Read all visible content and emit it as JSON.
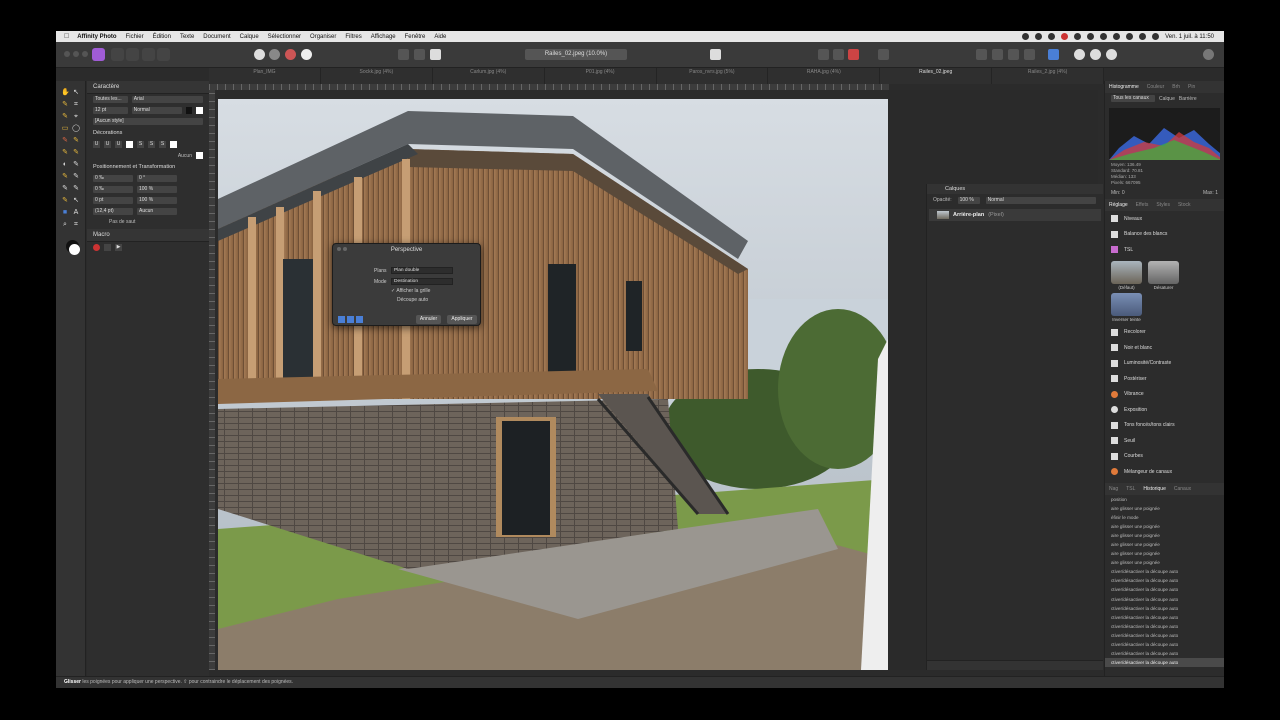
{
  "menubar": {
    "app_name": "Affinity Photo",
    "items": [
      "Fichier",
      "Édition",
      "Texte",
      "Document",
      "Calque",
      "Sélectionner",
      "Organiser",
      "Filtres",
      "Affichage",
      "Fenêtre",
      "Aide"
    ],
    "clock": "Ven. 1 juil. à 11:50"
  },
  "toolbar": {
    "document_title": "Railes_02.jpeg (10.0%)"
  },
  "tabs": [
    "Plan_IMG",
    "Sockk.jpg (4%)",
    "Carlum.jpg (4%)",
    "P01.jpg (4%)",
    "Paros_nvrs.jpg (5%)",
    "RAHA.jpg (4%)",
    "Railes_02.jpeg",
    "Railes_2.jpg (4%)"
  ],
  "character_panel": {
    "title": "Caractère",
    "font_family_label": "Toutes les...",
    "font_name": "Arial",
    "font_size": "12 pt",
    "font_style": "Normal",
    "style": "[Aucun style]",
    "decorations_title": "Décorations",
    "decorations": [
      "U",
      "U",
      "U",
      "S",
      "S",
      "S"
    ],
    "decoration_none": "Aucun",
    "positioning_title": "Positionnement et Transformation",
    "pos_rows": [
      {
        "a": "0 ‰",
        "b": "0 °"
      },
      {
        "a": "0 ‰",
        "b": "100 %"
      },
      {
        "a": "0 pt",
        "b": "100 %"
      },
      {
        "a": "(12,4 pt)",
        "b": "Aucun"
      }
    ],
    "no_grid": "Pas de saut",
    "macro_title": "Macro"
  },
  "perspective_dialog": {
    "title": "Perspective",
    "planes_label": "Plans",
    "planes_value": "Plan double",
    "mode_label": "Mode",
    "mode_value": "Destination",
    "show_grid": "Afficher la grille",
    "auto_crop": "Découpe auto",
    "cancel": "Annuler",
    "apply": "Appliquer"
  },
  "layers_panel": {
    "title": "Calques",
    "opacity_label": "Opacité:",
    "opacity_value": "100 %",
    "blend_mode": "Normal",
    "layer_name": "Arrière-plan",
    "layer_type": "(Pixel)"
  },
  "histogram_panel": {
    "tabs": [
      "Histogramme",
      "Couleur",
      "Brh",
      "Pin"
    ],
    "channels": "Tous les canaux",
    "layer": "Calque",
    "warnings": "Barrière",
    "stats": [
      "Moyen: 136.49",
      "Standard: 70.81",
      "Médian: 133",
      "Pixels: 667095"
    ],
    "min_label": "Min: 0",
    "max_label": "Max: 1",
    "colors": {
      "red": "#d23b3b",
      "green": "#3fae3f",
      "blue": "#3a66d8"
    }
  },
  "adjustments_panel": {
    "tabs": [
      "Réglage",
      "Effets",
      "Styles",
      "Stock"
    ],
    "items_top": [
      "Niveaux",
      "Balance des blancs",
      "TSL"
    ],
    "presets": [
      "(Défaut)",
      "Désaturer",
      "Inverser teinte"
    ],
    "items": [
      "Recolorer",
      "Noir et blanc",
      "Luminosité/Contraste",
      "Postériser",
      "Vibrance",
      "Exposition",
      "Tons foncés/tons clairs",
      "Seuil",
      "Courbes",
      "Mélangeur de canaux"
    ]
  },
  "history_panel": {
    "tabs": [
      "Nag",
      "TSL",
      "Historique",
      "Canaux"
    ],
    "top_label": "position",
    "items": [
      "aire glisser une poignée",
      "éfinir le mode",
      "aire glisser une poignée",
      "aire glisser une poignée",
      "aire glisser une poignée",
      "aire glisser une poignée",
      "aire glisser une poignée",
      "ctiver/désactiver la découpe auto",
      "ctiver/désactiver la découpe auto",
      "ctiver/désactiver la découpe auto",
      "ctiver/désactiver la découpe auto",
      "ctiver/désactiver la découpe auto",
      "ctiver/désactiver la découpe auto",
      "ctiver/désactiver la découpe auto",
      "ctiver/désactiver la découpe auto",
      "ctiver/désactiver la découpe auto",
      "ctiver/désactiver la découpe auto",
      "ctiver/désactiver la découpe auto"
    ]
  },
  "status_bar": {
    "bold": "Glisser",
    "text": "les poignées pour appliquer une perspective. ⇧ pour contraindre le déplacement des poignées."
  }
}
